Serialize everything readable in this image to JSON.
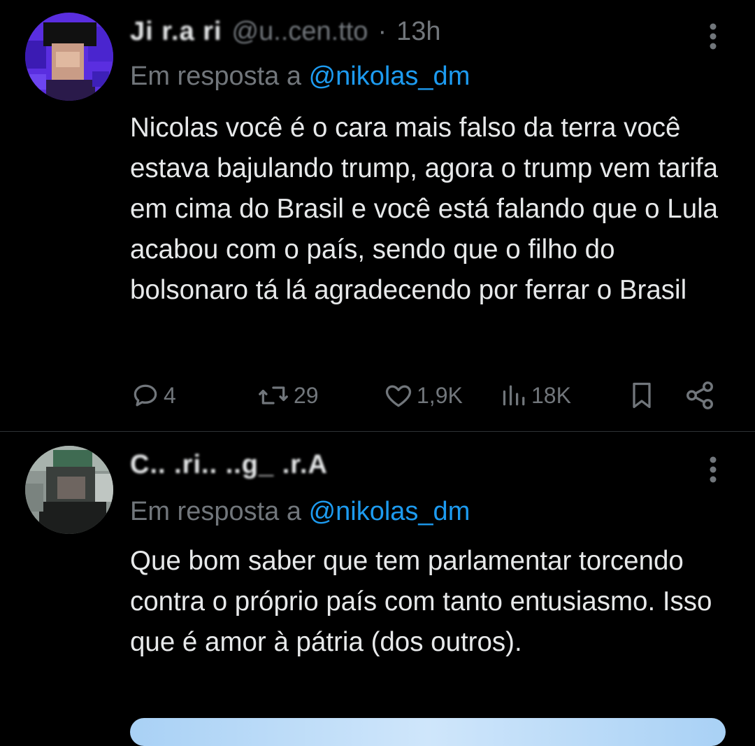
{
  "tweets": [
    {
      "name": "Ji r.a ri",
      "handle": "@u..cen.tto",
      "separator": "·",
      "time": "13h",
      "reply_prefix": "Em resposta a",
      "reply_mention": "@nikolas_dm",
      "text": "Nicolas você é o cara mais falso da terra você estava bajulando trump, agora o trump vem tarifa em cima do Brasil e você está falando que o Lula acabou com o país, sendo que o filho do bolsonaro tá lá agradecendo por ferrar o Brasil",
      "actions": {
        "replies": "4",
        "reposts": "29",
        "likes": "1,9K",
        "views": "18K"
      }
    },
    {
      "name": "C.. .ri.. ..g_ .r.A",
      "reply_prefix": "Em resposta a",
      "reply_mention": "@nikolas_dm",
      "text": "Que bom saber que tem parlamentar torcendo contra o próprio país com tanto entusiasmo. Isso que é amor à pátria (dos outros)."
    }
  ],
  "icons": {
    "reply": "reply-icon",
    "repost": "repost-icon",
    "like": "heart-icon",
    "views": "views-icon",
    "bookmark": "bookmark-icon",
    "share": "share-icon",
    "more": "more-vertical-icon"
  },
  "colors": {
    "background": "#000000",
    "text": "#e7e9ea",
    "secondary": "#71767b",
    "link": "#1d9bf0",
    "divider": "#2f3336"
  }
}
